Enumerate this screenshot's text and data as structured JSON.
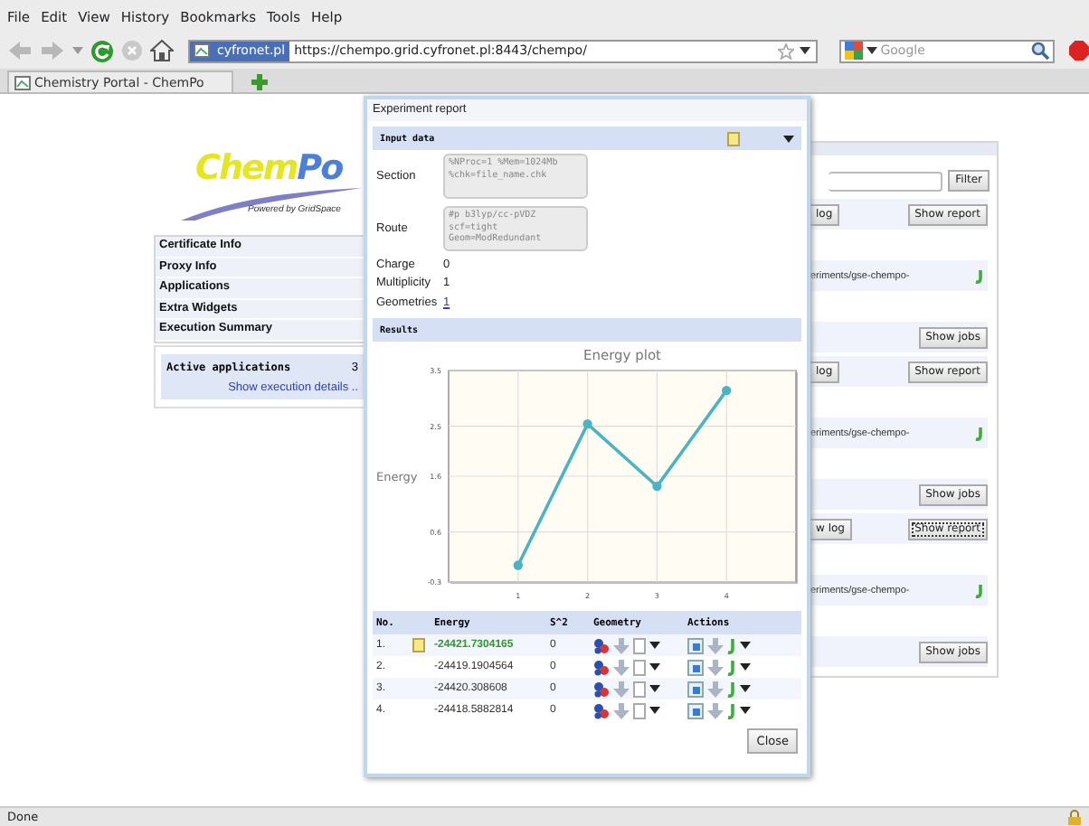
{
  "browser": {
    "menu": [
      "File",
      "Edit",
      "View",
      "History",
      "Bookmarks",
      "Tools",
      "Help"
    ],
    "site_badge": "cyfronet.pl",
    "url": "https://chempo.grid.cyfronet.pl:8443/chempo/",
    "search": {
      "placeholder": "Google"
    },
    "tabs": [
      {
        "label": "Chemistry Portal - ChemPo",
        "selected": true
      }
    ]
  },
  "sidebar": {
    "logo": [
      "Chem",
      "Po"
    ],
    "tagline": "Powered by GridSpace",
    "items": [
      {
        "label": "Certificate Info"
      },
      {
        "label": "Proxy Info"
      },
      {
        "label": "Applications"
      },
      {
        "label": "Extra Widgets"
      },
      {
        "label": "Execution Summary"
      }
    ],
    "summary": {
      "label": "Active applications",
      "count": "3",
      "link": "Show execution details .."
    }
  },
  "experiments": {
    "filter_button": "Filter",
    "groups": [
      {
        "log_button": "log",
        "report_button": "Show report",
        "report_focused": false,
        "path": "eriments/gse-chempo-",
        "jobs_button": "Show jobs"
      },
      {
        "log_button": "log",
        "report_button": "Show report",
        "report_focused": false,
        "path": "eriments/gse-chempo-",
        "jobs_button": "Show jobs"
      },
      {
        "log_button": "w log",
        "report_button": "Show report",
        "report_focused": true,
        "path": "eriments/gse-chempo-",
        "jobs_button": "Show jobs"
      }
    ]
  },
  "dialog": {
    "title": "Experiment report",
    "input_header": "Input data",
    "section": {
      "label": "Section",
      "lines": [
        "%NProc=1 %Mem=1024Mb",
        "%chk=file_name.chk"
      ]
    },
    "route": {
      "label": "Route",
      "lines": [
        "#p b3lyp/cc-pVDZ",
        "scf=tight",
        "Geom=ModRedundant"
      ]
    },
    "charge": {
      "label": "Charge",
      "value": "0"
    },
    "multiplicity": {
      "label": "Multiplicity",
      "value": "1"
    },
    "geometries": {
      "label": "Geometries",
      "link": "1"
    },
    "results_header": "Results",
    "chart_data": {
      "type": "line",
      "title": "Energy plot",
      "ylabel": "Energy",
      "categories": [
        "1",
        "2",
        "3",
        "4"
      ],
      "ylim": [
        -0.3,
        3.5
      ],
      "yticks": [
        -0.3,
        0.6,
        1.6,
        2.5,
        3.5
      ],
      "grid": true,
      "series": [
        {
          "color": "#4bb3c4",
          "marker": "circle",
          "values": [
            0,
            2.54,
            1.42,
            3.14
          ]
        }
      ]
    },
    "table": {
      "columns": [
        "No.",
        "Energy",
        "S^2",
        "Geometry",
        "Actions"
      ],
      "rows": [
        {
          "no": "1.",
          "energy": "-24421.7304165",
          "s2": "0",
          "best": true
        },
        {
          "no": "2.",
          "energy": "-24419.1904564",
          "s2": "0",
          "best": false
        },
        {
          "no": "3.",
          "energy": "-24420.308608",
          "s2": "0",
          "best": false
        },
        {
          "no": "4.",
          "energy": "-24418.5882814",
          "s2": "0",
          "best": false
        }
      ]
    },
    "close_button": "Close"
  },
  "status_bar": {
    "text": "Done"
  }
}
